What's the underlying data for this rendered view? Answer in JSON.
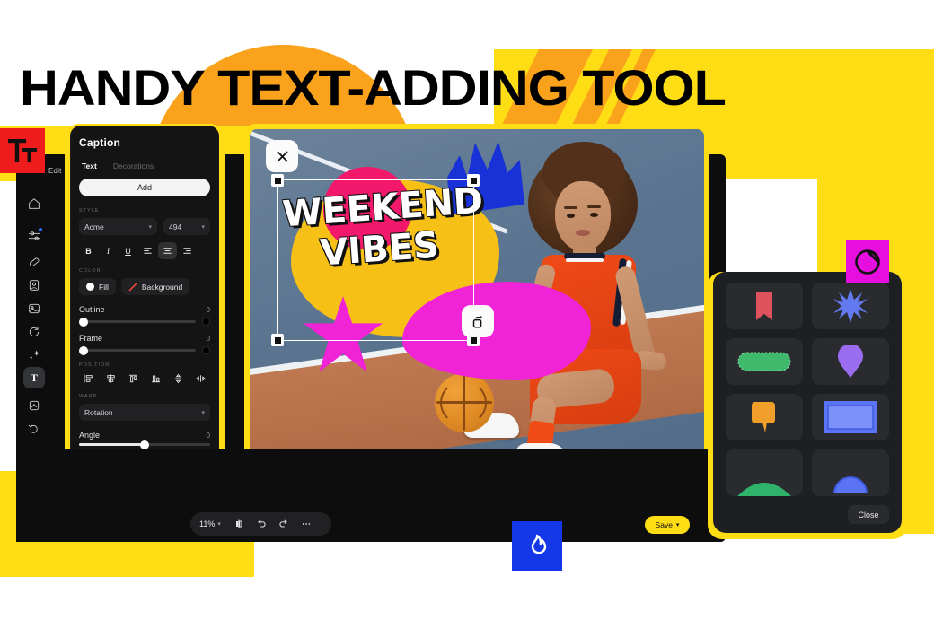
{
  "headline": "HANDY TEXT-ADDING TOOL",
  "brand": {
    "logo_text": "Tt",
    "edit_label": "Edit",
    "logo_color": "#EE1C1C"
  },
  "theme": {
    "yellow": "#FFDD15",
    "orange": "#FAA21B",
    "blue": "#1438E8",
    "magenta": "#E60FE0",
    "panel_bg": "#141414"
  },
  "rail": {
    "items": [
      {
        "name": "home-icon",
        "label": "Home"
      },
      {
        "name": "adjustments-icon",
        "label": "Adjust",
        "badge": true
      },
      {
        "name": "eraser-icon",
        "label": "Eraser"
      },
      {
        "name": "portrait-icon",
        "label": "Portrait"
      },
      {
        "name": "image-icon",
        "label": "Image"
      },
      {
        "name": "rotate-icon",
        "label": "Rotate"
      },
      {
        "name": "magic-icon",
        "label": "Effects"
      },
      {
        "name": "text-icon",
        "label": "T",
        "active": true
      },
      {
        "name": "shapes-icon",
        "label": "Shapes"
      },
      {
        "name": "retouch-icon",
        "label": "Retouch"
      }
    ]
  },
  "panel": {
    "title": "Caption",
    "tabs": [
      {
        "label": "Text",
        "active": true
      },
      {
        "label": "Decorations",
        "active": false
      }
    ],
    "add_label": "Add",
    "style_label": "STYLE",
    "font_value": "Acme",
    "size_value": "494",
    "format_buttons": [
      "B",
      "I",
      "U"
    ],
    "align_buttons": [
      "align-left",
      "align-center",
      "align-right"
    ],
    "color_label": "COLOR",
    "fill_label": "Fill",
    "background_label": "Background",
    "outline_label": "Outline",
    "outline_value": "0",
    "frame_label": "Frame",
    "frame_value": "0",
    "position_label": "POSITION",
    "warp_label": "WARP",
    "warp_value": "Rotation",
    "angle_label": "Angle",
    "angle_value": "0"
  },
  "canvas": {
    "caption_line1": "WEEKEND",
    "caption_line2": "VIBES",
    "close_icon": "close-icon",
    "rotate_icon": "rotate-icon"
  },
  "toolbar": {
    "zoom_value": "11%",
    "compare_icon": "compare-icon",
    "undo_icon": "undo-icon",
    "redo_icon": "redo-icon",
    "more_icon": "more-icon",
    "save_label": "Save"
  },
  "shapes_panel": {
    "close_label": "Close",
    "badge_icon": "pie-chart-icon",
    "items": [
      {
        "name": "bookmark-shape",
        "color": "#E0515E"
      },
      {
        "name": "star-shape",
        "color": "#6279F0"
      },
      {
        "name": "rounded-bar-shape",
        "color": "#3FB96B"
      },
      {
        "name": "map-pin-shape",
        "color": "#9A6CF0"
      },
      {
        "name": "speech-bubble-shape",
        "color": "#F0A02A"
      },
      {
        "name": "stamp-frame-shape",
        "color": "#5A74F5"
      },
      {
        "name": "arc-shape",
        "color": "#2FB36A"
      },
      {
        "name": "semicircle-shape",
        "color": "#5A74F5"
      }
    ]
  },
  "flame_badge": {
    "icon": "flame-icon"
  }
}
